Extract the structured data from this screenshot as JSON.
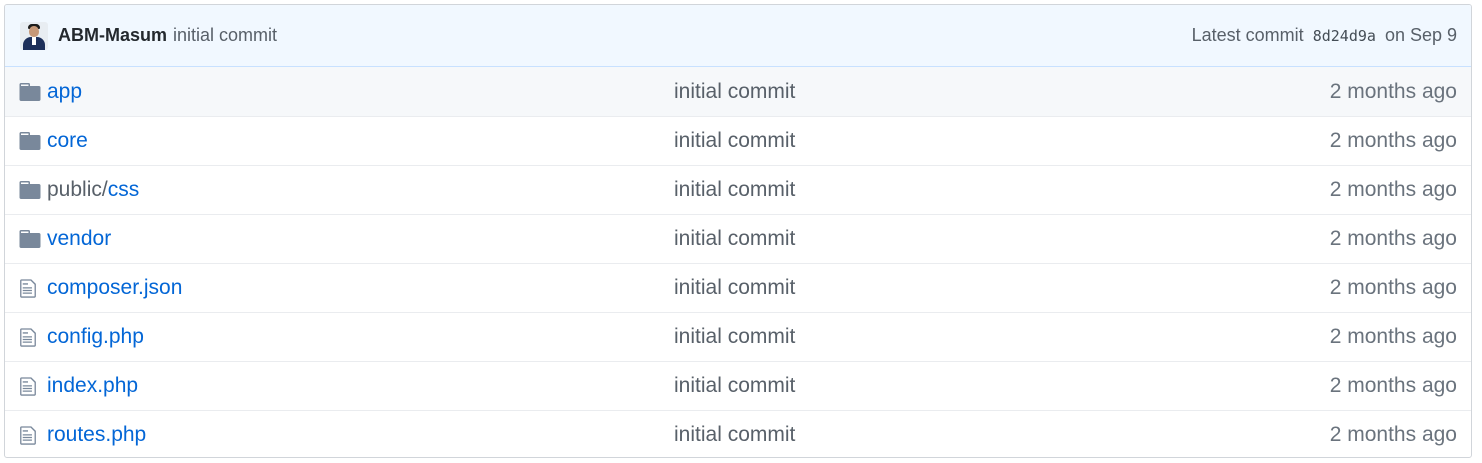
{
  "latest_commit": {
    "author": "ABM-Masum",
    "message": "initial commit",
    "prefix": "Latest commit",
    "sha": "8d24d9a",
    "date": "on Sep 9"
  },
  "files": [
    {
      "type": "folder",
      "icon": "folder-icon",
      "prefix": "",
      "name": "app",
      "message": "initial commit",
      "age": "2 months ago"
    },
    {
      "type": "folder",
      "icon": "folder-icon",
      "prefix": "",
      "name": "core",
      "message": "initial commit",
      "age": "2 months ago"
    },
    {
      "type": "folder",
      "icon": "folder-icon",
      "prefix": "public/",
      "name": "css",
      "message": "initial commit",
      "age": "2 months ago"
    },
    {
      "type": "folder",
      "icon": "folder-icon",
      "prefix": "",
      "name": "vendor",
      "message": "initial commit",
      "age": "2 months ago"
    },
    {
      "type": "file",
      "icon": "file-icon",
      "prefix": "",
      "name": "composer.json",
      "message": "initial commit",
      "age": "2 months ago"
    },
    {
      "type": "file",
      "icon": "file-icon",
      "prefix": "",
      "name": "config.php",
      "message": "initial commit",
      "age": "2 months ago"
    },
    {
      "type": "file",
      "icon": "file-icon",
      "prefix": "",
      "name": "index.php",
      "message": "initial commit",
      "age": "2 months ago"
    },
    {
      "type": "file",
      "icon": "file-icon",
      "prefix": "",
      "name": "routes.php",
      "message": "initial commit",
      "age": "2 months ago"
    }
  ],
  "colors": {
    "link": "#0366d6",
    "commit_bar_bg": "#f1f8ff",
    "icon": "#79889b"
  }
}
